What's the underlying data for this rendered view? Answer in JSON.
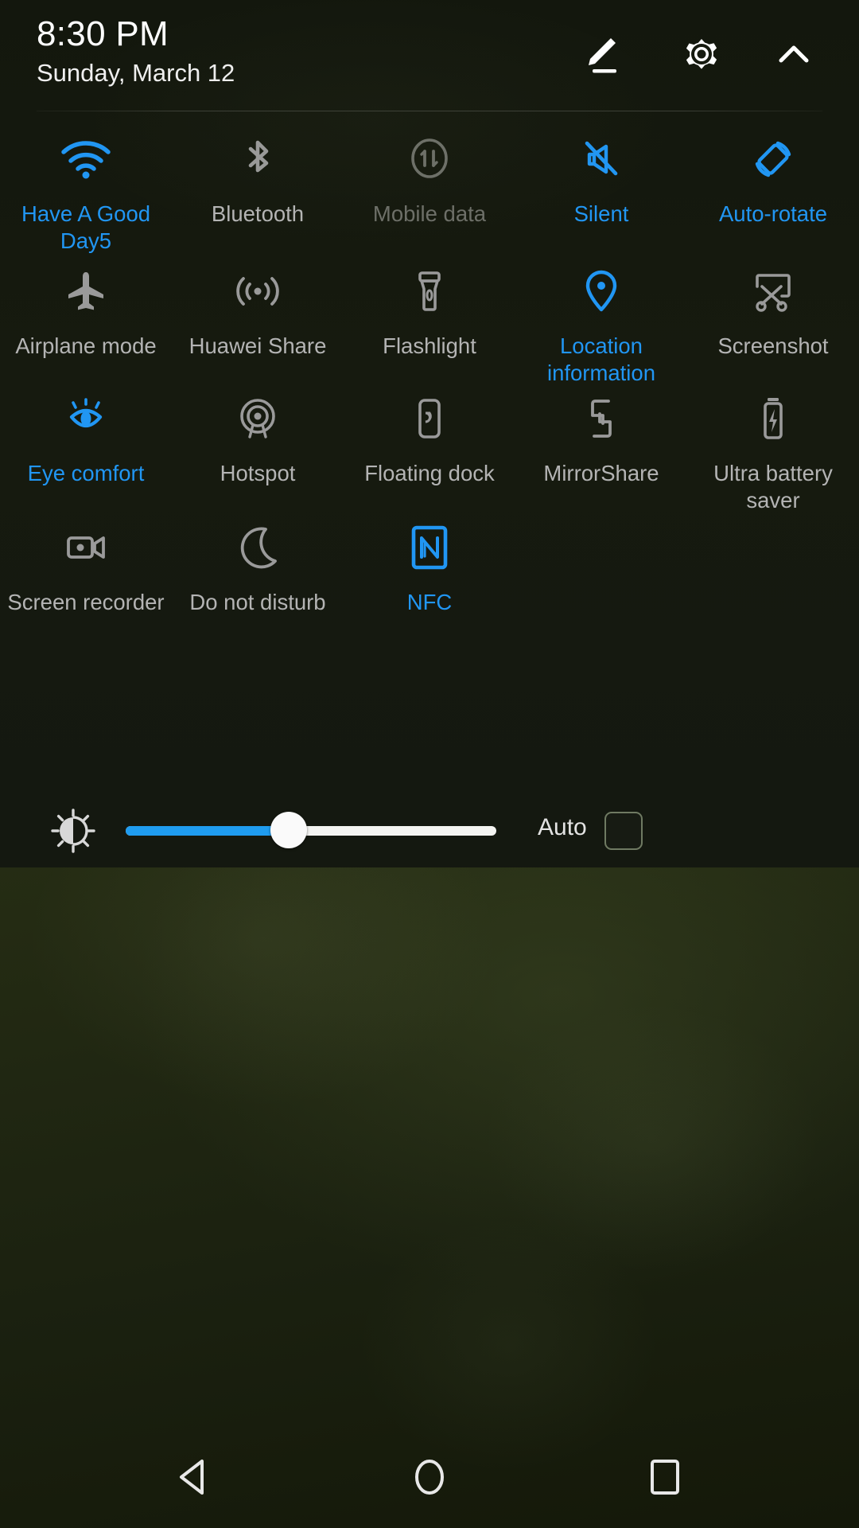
{
  "header": {
    "time": "8:30 PM",
    "date": "Sunday, March 12",
    "edit_icon": "pencil-edit-icon",
    "settings_icon": "gear-icon",
    "collapse_icon": "chevron-up-icon"
  },
  "colors": {
    "accent_active": "#2196f3",
    "label_inactive": "#b4b4b4",
    "label_disabled": "#6d6f68",
    "panel_background": "#161a0f",
    "slider_fill": "#1f9cf0",
    "slider_track": "#f4f4f2"
  },
  "tiles": [
    [
      {
        "label": "Have A Good Day5",
        "icon": "wifi-icon",
        "state": "on"
      },
      {
        "label": "Bluetooth",
        "icon": "bluetooth-icon",
        "state": "off"
      },
      {
        "label": "Mobile data",
        "icon": "mobile-data-icon",
        "state": "disabled"
      },
      {
        "label": "Silent",
        "icon": "silent-bell-icon",
        "state": "on"
      },
      {
        "label": "Auto-rotate",
        "icon": "auto-rotate-icon",
        "state": "on"
      }
    ],
    [
      {
        "label": "Airplane mode",
        "icon": "airplane-icon",
        "state": "off"
      },
      {
        "label": "Huawei Share",
        "icon": "huawei-share-icon",
        "state": "off"
      },
      {
        "label": "Flashlight",
        "icon": "flashlight-icon",
        "state": "off"
      },
      {
        "label": "Location information",
        "icon": "location-pin-icon",
        "state": "on"
      },
      {
        "label": "Screenshot",
        "icon": "screenshot-scissors-icon",
        "state": "off"
      }
    ],
    [
      {
        "label": "Eye comfort",
        "icon": "eye-comfort-icon",
        "state": "on"
      },
      {
        "label": "Hotspot",
        "icon": "hotspot-icon",
        "state": "off"
      },
      {
        "label": "Floating dock",
        "icon": "floating-dock-icon",
        "state": "off"
      },
      {
        "label": "MirrorShare",
        "icon": "mirror-share-icon",
        "state": "off"
      },
      {
        "label": "Ultra battery saver",
        "icon": "ultra-battery-saver-icon",
        "state": "off"
      }
    ],
    [
      {
        "label": "Screen recorder",
        "icon": "screen-recorder-icon",
        "state": "off"
      },
      {
        "label": "Do not disturb",
        "icon": "moon-icon",
        "state": "off"
      },
      {
        "label": "NFC",
        "icon": "nfc-icon",
        "state": "on"
      },
      {
        "label": "",
        "icon": "",
        "state": "empty"
      },
      {
        "label": "",
        "icon": "",
        "state": "empty"
      }
    ]
  ],
  "brightness": {
    "icon": "brightness-sun-icon",
    "value_percent": 44,
    "auto_label": "Auto",
    "auto_checked": false
  },
  "navbar": {
    "back_icon": "back-triangle-icon",
    "home_icon": "home-circle-icon",
    "recents_icon": "recents-square-icon"
  }
}
